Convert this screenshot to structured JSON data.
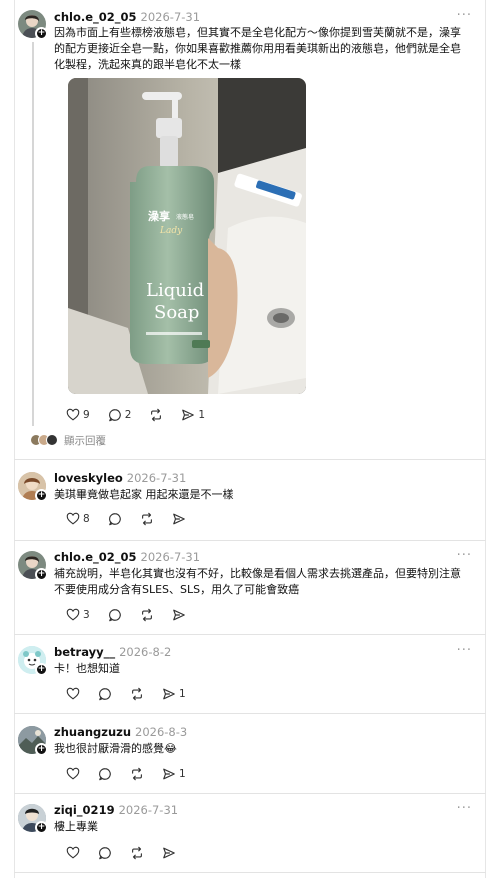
{
  "more_label": "···",
  "posts": [
    {
      "username": "chlo.e_02_05",
      "date": "2026-7-31",
      "text": "因為市面上有些標榜液態皂，但其實不是全皂化配方～像你提到雪芙蘭就不是，澡享的配方更接近全皂一點，你如果喜歡推薦你用用看美琪新出的液態皂，他們就是全皂化製程，洗起來真的跟半皂化不太一樣",
      "likes": "9",
      "comments": "2",
      "shares": "1",
      "image": {
        "brand": "澡享",
        "brand_sub": "液態皂",
        "script": "Lady",
        "title_line1": "Liquid",
        "title_line2": "Soap"
      },
      "replies_label": "顯示回覆"
    },
    {
      "username": "loveskyleo",
      "date": "2026-7-31",
      "text": "美琪畢竟做皂起家 用起來還是不一樣",
      "likes": "8"
    },
    {
      "username": "chlo.e_02_05",
      "date": "2026-7-31",
      "text": "補充說明，半皂化其實也沒有不好，比較像是看個人需求去挑選產品，但要特別注意不要使用成分含有SLES、SLS，用久了可能會致癌",
      "likes": "3"
    },
    {
      "username": "betrayy__",
      "date": "2026-8-2",
      "text": "卡！也想知道",
      "shares": "1"
    },
    {
      "username": "zhuangzuzu",
      "date": "2026-8-3",
      "text": "我也很討厭滑滑的感覺😂",
      "shares": "1"
    },
    {
      "username": "ziqi_0219",
      "date": "2026-7-31",
      "text": "樓上專業"
    }
  ],
  "colors": {
    "text": "#111111",
    "muted": "#9a9a9a",
    "divider": "#e3e3e3",
    "bottle": "#8fae97"
  },
  "icons": [
    "heart-icon",
    "comment-icon",
    "repost-icon",
    "share-icon",
    "more-icon",
    "follow-plus-icon"
  ]
}
